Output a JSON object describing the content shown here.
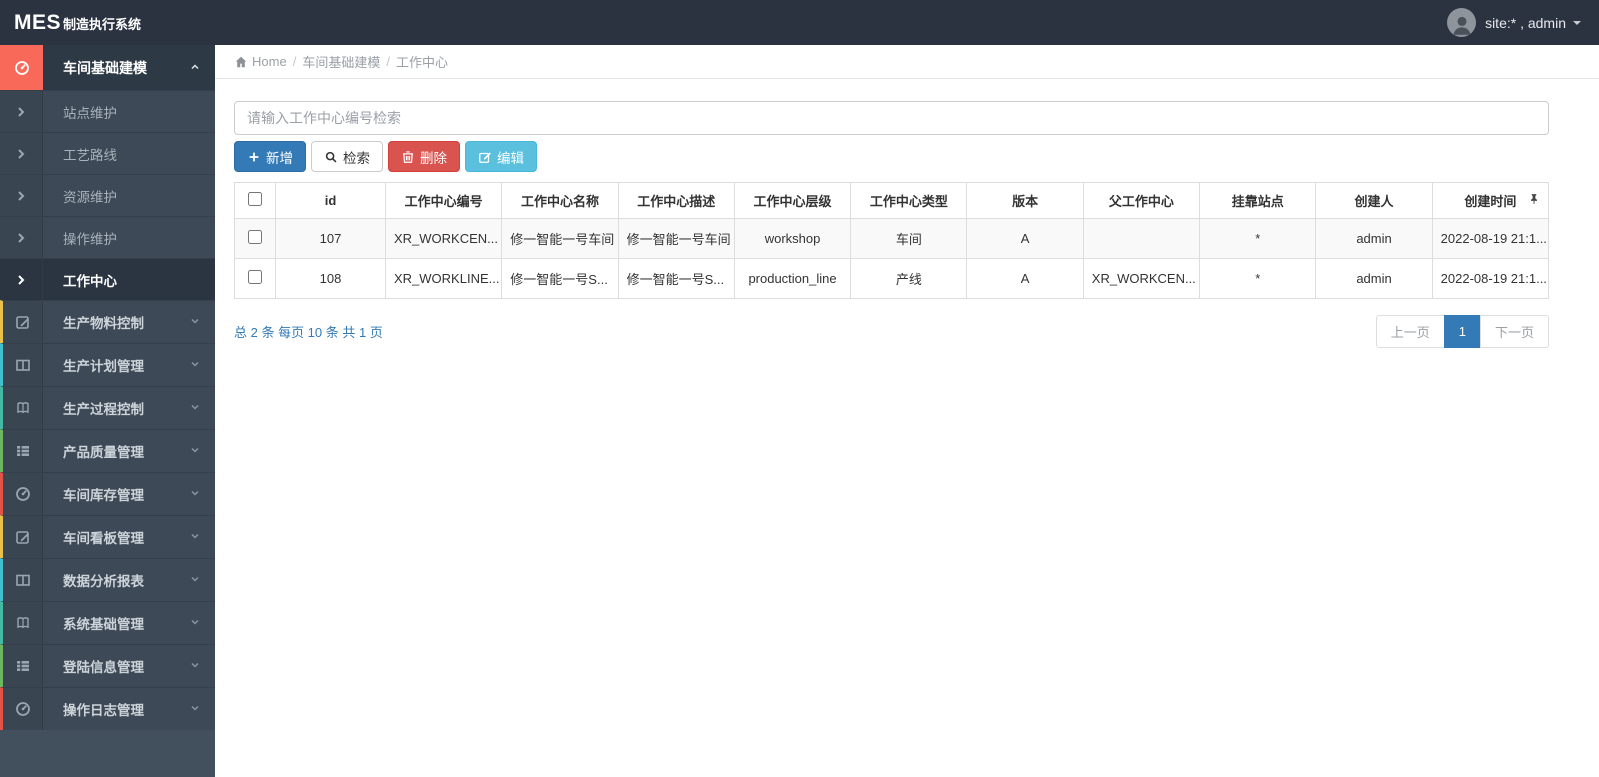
{
  "navbar": {
    "brand_primary": "MES",
    "brand_secondary": "制造执行系统",
    "user_label": "site:* , admin"
  },
  "breadcrumb": {
    "home": "Home",
    "separator": "/",
    "section": "车间基础建模",
    "current": "工作中心"
  },
  "sidebar": {
    "active_section": {
      "label": "车间基础建模",
      "icon": "gauge-icon",
      "accent": "#f9695a"
    },
    "sub_items": [
      {
        "label": "站点维护"
      },
      {
        "label": "工艺路线"
      },
      {
        "label": "资源维护"
      },
      {
        "label": "操作维护"
      },
      {
        "label": "工作中心",
        "active": true
      }
    ],
    "sections": [
      {
        "label": "生产物料控制",
        "icon": "pencil-square-icon",
        "accent": "#e9c04b"
      },
      {
        "label": "生产计划管理",
        "icon": "columns-icon",
        "accent": "#41c0c9"
      },
      {
        "label": "生产过程控制",
        "icon": "book-icon",
        "accent": "#43b9a5"
      },
      {
        "label": "产品质量管理",
        "icon": "list-icon",
        "accent": "#6cb75f"
      },
      {
        "label": "车间库存管理",
        "icon": "gauge-icon",
        "accent": "#e05448"
      },
      {
        "label": "车间看板管理",
        "icon": "pencil-square-icon",
        "accent": "#e9c04b"
      },
      {
        "label": "数据分析报表",
        "icon": "columns-icon",
        "accent": "#41c0c9"
      },
      {
        "label": "系统基础管理",
        "icon": "book-icon",
        "accent": "#43b9a5"
      },
      {
        "label": "登陆信息管理",
        "icon": "list-icon",
        "accent": "#6cb75f"
      },
      {
        "label": "操作日志管理",
        "icon": "gauge-icon",
        "accent": "#e05448"
      }
    ]
  },
  "toolbar": {
    "search_placeholder": "请输入工作中心编号检索",
    "add_label": "新增",
    "search_label": "检索",
    "delete_label": "删除",
    "edit_label": "编辑"
  },
  "table": {
    "columns": [
      "id",
      "工作中心编号",
      "工作中心名称",
      "工作中心描述",
      "工作中心层级",
      "工作中心类型",
      "版本",
      "父工作中心",
      "挂靠站点",
      "创建人",
      "创建时间"
    ],
    "rows": [
      [
        "107",
        "XR_WORKCEN...",
        "修一智能一号车间",
        "修一智能一号车间",
        "workshop",
        "车间",
        "A",
        "",
        "*",
        "admin",
        "2022-08-19 21:1..."
      ],
      [
        "108",
        "XR_WORKLINE...",
        "修一智能一号S...",
        "修一智能一号S...",
        "production_line",
        "产线",
        "A",
        "XR_WORKCEN...",
        "*",
        "admin",
        "2022-08-19 21:1..."
      ]
    ]
  },
  "pagination": {
    "summary": "总 2 条 每页 10 条 共 1 页",
    "prev": "上一页",
    "current": "1",
    "next": "下一页"
  },
  "colors": {
    "navbar_bg": "#2b3340",
    "sidebar_bg": "#424f5c",
    "active_menu_accent": "#f9695a",
    "primary_button": "#337ab7",
    "danger_button": "#d9534f",
    "info_button": "#5bc0de",
    "link_text": "#337ab7",
    "pagination_active": "#337ab7"
  }
}
